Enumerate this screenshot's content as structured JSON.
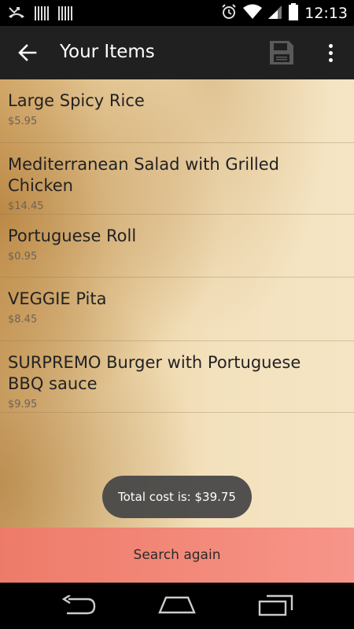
{
  "status_bar": {
    "time": "12:13",
    "icons": [
      "missed-call-icon",
      "barcode-icon",
      "barcode-icon",
      "alarm-icon",
      "wifi-icon",
      "signal-icon",
      "battery-icon"
    ]
  },
  "action_bar": {
    "title": "Your Items",
    "back_icon": "arrow-back-icon",
    "save_icon": "save-icon",
    "menu_icon": "overflow-menu-icon"
  },
  "items": [
    {
      "name": "Large Spicy Rice",
      "price": "$5.95"
    },
    {
      "name": "Mediterranean Salad with Grilled Chicken",
      "price": "$14.45"
    },
    {
      "name": "Portuguese Roll",
      "price": "$0.95"
    },
    {
      "name": "VEGGIE Pita",
      "price": "$8.45"
    },
    {
      "name": "SURPREMO Burger with Portuguese BBQ sauce",
      "price": "$9.95"
    }
  ],
  "toast": {
    "text": "Total cost is: $39.75"
  },
  "search_again": {
    "label": "Search again"
  },
  "nav_bar": {
    "icons": [
      "back-icon",
      "home-icon",
      "recents-icon"
    ]
  },
  "colors": {
    "action_bar": "#202020",
    "search_again": "#f28878",
    "toast": "#484848"
  }
}
